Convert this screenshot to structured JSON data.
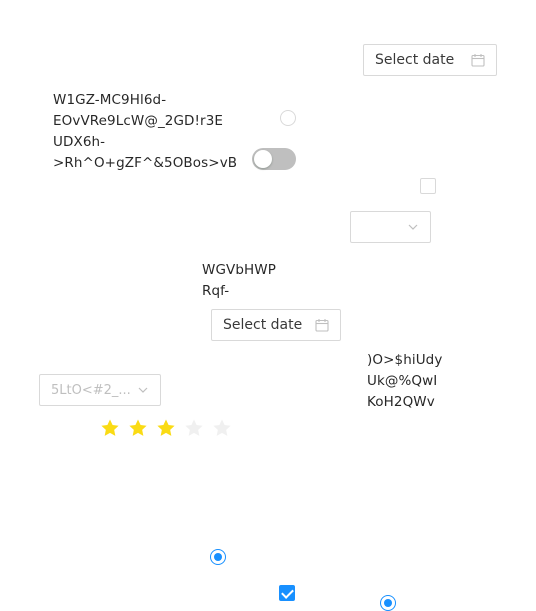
{
  "datepicker_top": {
    "placeholder": "Select date"
  },
  "datepicker_mid": {
    "placeholder": "Select date"
  },
  "text_block_1": {
    "lines": [
      "W1GZ-MC9Hl6d-",
      "EOvVRe9LcW@_2GD!r3E",
      "UDX6h-",
      ">Rh^O+gZF^&5OBos>vB"
    ]
  },
  "text_block_2": {
    "lines": [
      "WGVbHWP",
      "Rqf-"
    ]
  },
  "text_block_3": {
    "lines": [
      ")O>$hiUdy",
      "Uk@%QwI",
      "KoH2QWv"
    ]
  },
  "switch_1": {
    "checked": false
  },
  "select_empty": {
    "value": ""
  },
  "select_left": {
    "value": "5LtO<#2_..."
  },
  "rate": {
    "value": 3,
    "max": 5
  },
  "colors": {
    "primary": "#1890ff",
    "star_active": "#fadb14",
    "star_inactive": "#f0f0f0",
    "border": "#d9d9d9"
  },
  "icons": {
    "calendar": "calendar-icon",
    "chevron": "chevron-down-icon",
    "star": "star-icon"
  }
}
